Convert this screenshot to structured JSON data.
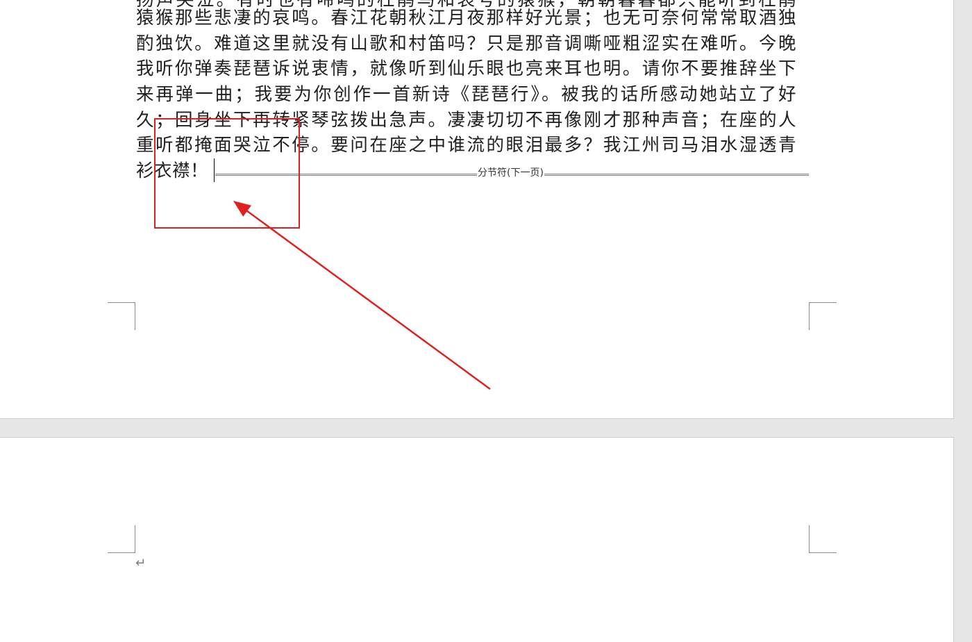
{
  "document": {
    "pages": [
      {
        "lines": [
          "扬声哭泣。有时也有啼鸣的杜鹃鸟和哀号的猿猴，朝朝暮暮都只能听到杜鹃",
          "猿猴那些悲凄的哀鸣。春江花朝秋江月夜那样好光景；也无可奈何常常取酒独",
          "酌独饮。难道这里就没有山歌和村笛吗？只是那音调嘶哑粗涩实在难听。今晚",
          "我听你弹奏琵琶诉说衷情，就像听到仙乐眼也亮来耳也明。请你不要推辞坐下",
          "来再弹一曲；我要为你创作一首新诗《琵琶行》。被我的话所感动她站立了好",
          "久；回身坐下再转紧琴弦拨出急声。凄凄切切不再像刚才那种声音；在座的人",
          "重听都掩面哭泣不停。要问在座之中谁流的眼泪最多？我江州司马泪水湿透青",
          "衫衣襟！"
        ],
        "section_break_label": "分节符(下一页)"
      },
      {
        "paragraph_mark": "↵"
      }
    ]
  },
  "annotation": {
    "color": "#e02020",
    "shapes": [
      "highlight-rectangle",
      "pointer-arrow"
    ]
  }
}
